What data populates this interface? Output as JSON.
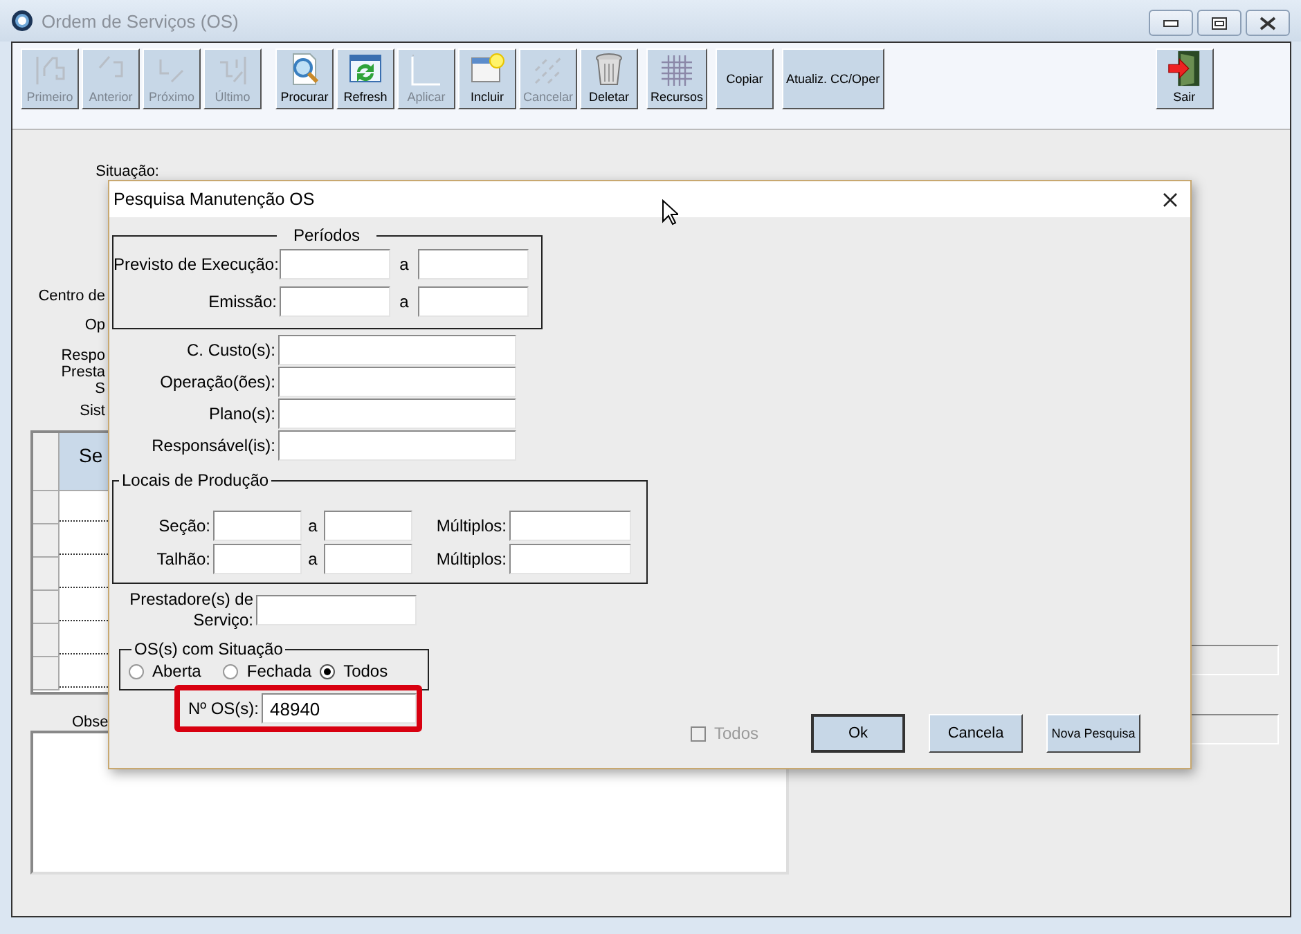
{
  "window": {
    "title": "Ordem de Serviços (OS)"
  },
  "toolbar": [
    {
      "label": "Primeiro",
      "kind": "first",
      "disabled": true
    },
    {
      "label": "Anterior",
      "kind": "previous",
      "disabled": true
    },
    {
      "label": "Próximo",
      "kind": "next",
      "disabled": true
    },
    {
      "label": "Último",
      "kind": "last",
      "disabled": true
    },
    {
      "label": "Procurar",
      "kind": "search",
      "disabled": false
    },
    {
      "label": "Refresh",
      "kind": "refresh",
      "disabled": false
    },
    {
      "label": "Aplicar",
      "kind": "apply",
      "disabled": true
    },
    {
      "label": "Incluir",
      "kind": "new",
      "disabled": false
    },
    {
      "label": "Cancelar",
      "kind": "cancel",
      "disabled": true
    },
    {
      "label": "Deletar",
      "kind": "trash",
      "disabled": false
    },
    {
      "label": "Recursos",
      "kind": "grid",
      "disabled": false
    },
    {
      "label": "Copiar",
      "kind": "text",
      "disabled": false
    },
    {
      "label": "Atualiz. CC/Oper",
      "kind": "text",
      "disabled": false
    },
    {
      "label": "Sair",
      "kind": "exit",
      "disabled": false
    }
  ],
  "background_form": {
    "labels": [
      "Situação:",
      "Centro de",
      "Op",
      "Respo",
      "Presta",
      "S",
      "Sist"
    ],
    "grid": {
      "column_1": "Se"
    },
    "group_label": "Obse"
  },
  "dialog": {
    "title": "Pesquisa Manutenção OS",
    "periods": {
      "legend": "Períodos",
      "rows": [
        {
          "label": "Previsto de Execução:",
          "separator": "a"
        },
        {
          "label": "Emissão:",
          "separator": "a"
        }
      ]
    },
    "fields": [
      {
        "label": "C. Custo(s):"
      },
      {
        "label": "Operação(ões):"
      },
      {
        "label": "Plano(s):"
      },
      {
        "label": "Responsável(is):"
      }
    ],
    "locations": {
      "legend": "Locais de Produção",
      "rows": [
        {
          "label": "Seção:",
          "separator": "a",
          "multiple_label": "Múltiplos:"
        },
        {
          "label": "Talhão:",
          "separator": "a",
          "multiple_label": "Múltiplos:"
        }
      ]
    },
    "providers": {
      "label_lines": [
        "Prestadore(s) de",
        "Serviço:"
      ]
    },
    "status": {
      "legend": "OS(s) com Situação",
      "options": [
        {
          "label": "Aberta",
          "selected": false
        },
        {
          "label": "Fechada",
          "selected": false
        },
        {
          "label": "Todos",
          "selected": true
        }
      ]
    },
    "os_number": {
      "label": "Nº OS(s):",
      "value": "48940",
      "highlighted": true
    },
    "all_checkbox": {
      "label": "Todos",
      "checked": false,
      "disabled": true
    },
    "buttons": [
      {
        "label": "Ok",
        "default": true
      },
      {
        "label": "Cancela",
        "default": false
      },
      {
        "label": "Nova Pesquisa",
        "default": false
      }
    ]
  }
}
